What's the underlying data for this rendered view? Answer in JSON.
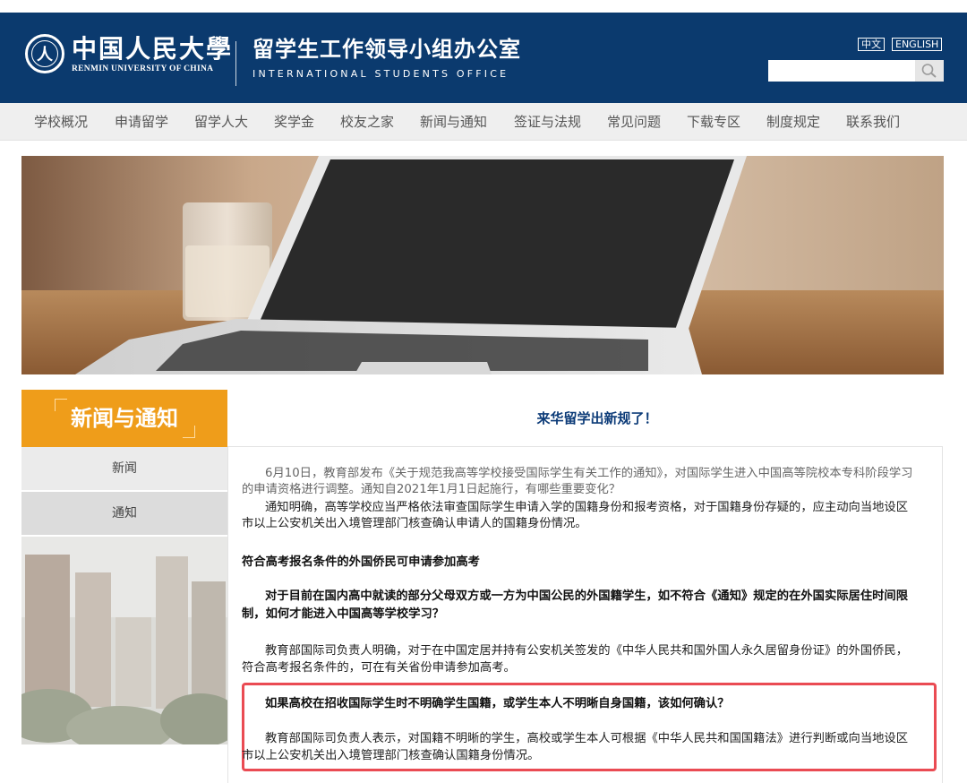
{
  "header": {
    "school_cn": "中国人民大學",
    "school_en": "RENMIN UNIVERSITY OF CHINA",
    "office_cn": "留学生工作领导小组办公室",
    "office_en": "INTERNATIONAL STUDENTS OFFICE",
    "lang_cn": "中文",
    "lang_en": "ENGLISH",
    "search_placeholder": ""
  },
  "nav": {
    "items": [
      "学校概况",
      "申请留学",
      "留学人大",
      "奖学金",
      "校友之家",
      "新闻与通知",
      "签证与法规",
      "常见问题",
      "下载专区",
      "制度规定",
      "联系我们"
    ]
  },
  "sidebar": {
    "title": "新闻与通知",
    "items": [
      "新闻",
      "通知"
    ]
  },
  "article": {
    "title": "来华留学出新规了！",
    "p1": "6月10日，教育部发布《关于规范我高等学校接受国际学生有关工作的通知》，对国际学生进入中国高等院校本专科阶段学习的申请资格进行调整。通知自2021年1月1日起施行，有哪些重要变化？",
    "p2": "通知明确，高等学校应当严格依法审查国际学生申请入学的国籍身份和报考资格，对于国籍身份存疑的，应主动向当地设区市以上公安机关出入境管理部门核查确认申请人的国籍身份情况。",
    "h1": "符合高考报名条件的外国侨民可申请参加高考",
    "q1": "对于目前在国内高中就读的部分父母双方或一方为中国公民的外国籍学生，如不符合《通知》规定的在外国实际居住时间限制，如何才能进入中国高等学校学习？",
    "a1": "教育部国际司负责人明确，对于在中国定居并持有公安机关签发的《中华人民共和国外国人永久居留身份证》的外国侨民，符合高考报名条件的，可在有关省份申请参加高考。",
    "q2": "如果高校在招收国际学生时不明确学生国籍，或学生本人不明晰自身国籍，该如何确认？",
    "a2": "教育部国际司负责人表示，对国籍不明晰的学生，高校或学生本人可根据《中华人民共和国国籍法》进行判断或向当地设区市以上公安机关出入境管理部门核查确认国籍身份情况。"
  },
  "colors": {
    "header_bg": "#0b3a6e",
    "nav_bg": "#efefef",
    "sidebar_title_bg": "#ef9d1a",
    "title_blue": "#0c3b78",
    "highlight_red": "#ea4b53"
  },
  "icons": {
    "search": "magnifier-icon",
    "seal": "university-seal-icon"
  }
}
